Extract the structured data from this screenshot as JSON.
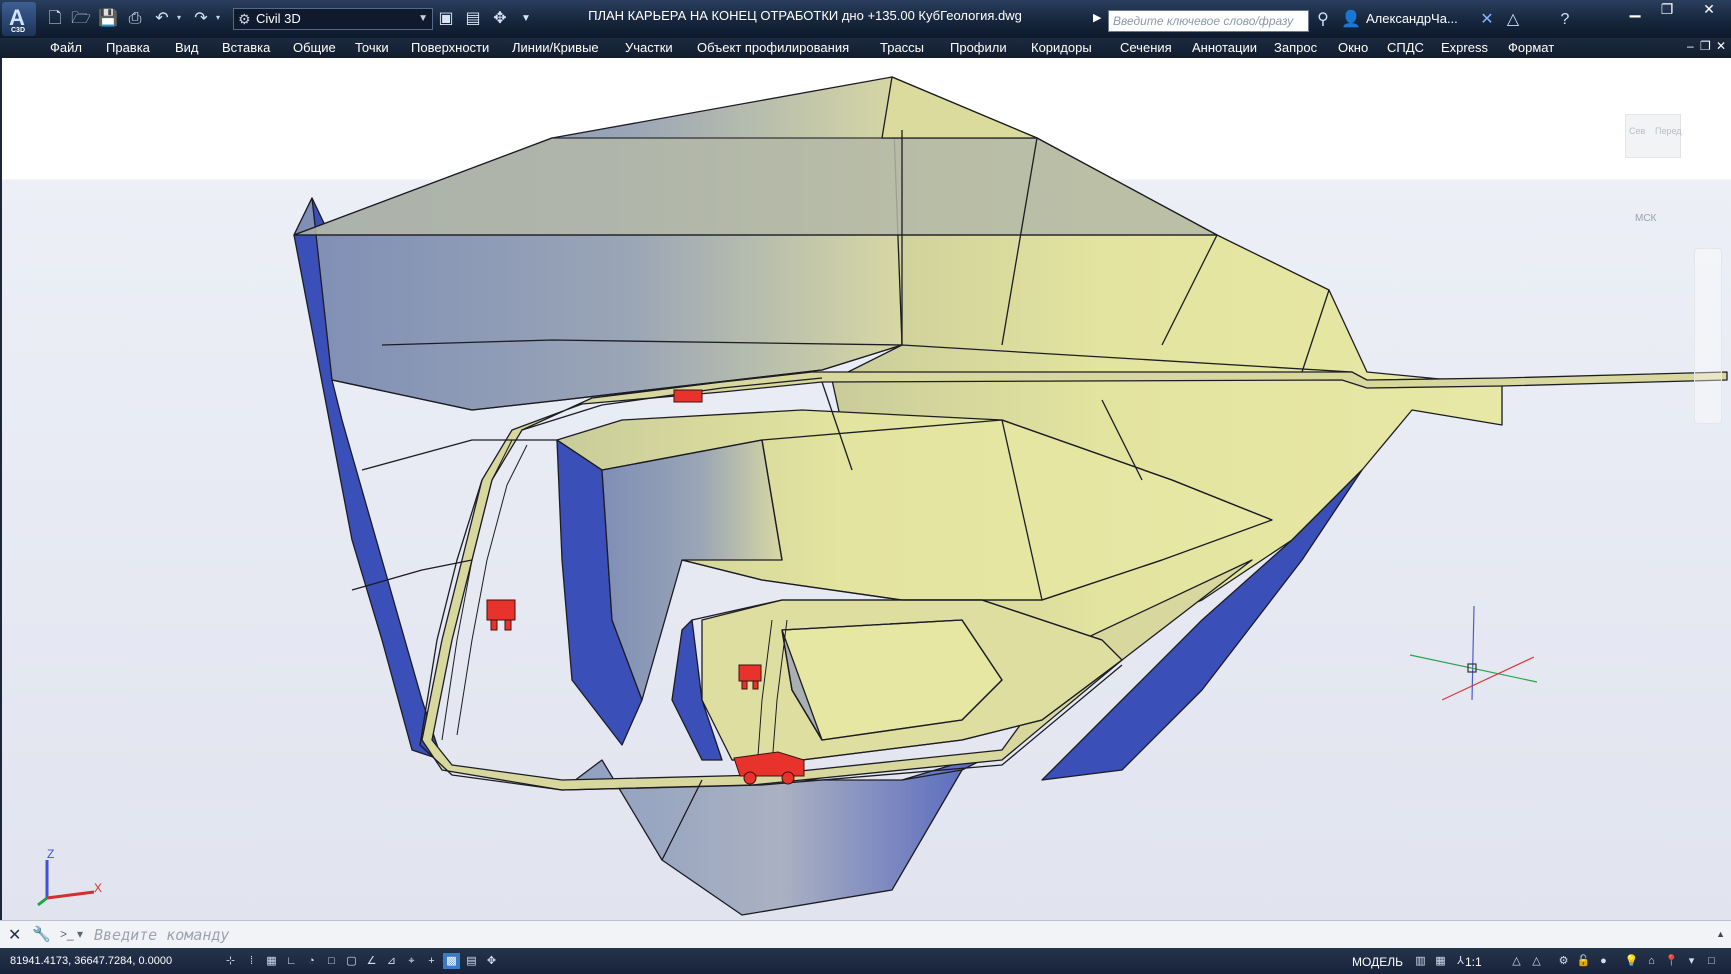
{
  "titlebar": {
    "app_letter": "A",
    "app_sub": "C3D",
    "workspace": "Civil 3D",
    "document_title": "ПЛАН КАРЬЕРА НА КОНЕЦ ОТРАБОТКИ дно +135.00 КубГеология.dwg",
    "search_placeholder": "Введите ключевое слово/фразу",
    "user_name": "АлександрЧа...",
    "help_icon": "?"
  },
  "menu": {
    "items": [
      "Файл",
      "Правка",
      "Вид",
      "Вставка",
      "Общие",
      "Точки",
      "Поверхности",
      "Линии/Кривые",
      "Участки",
      "Объект профилирования",
      "Трассы",
      "Профили",
      "Коридоры",
      "Сечения",
      "Аннотации",
      "Запрос",
      "Окно",
      "СПДС",
      "Express",
      "Формат"
    ]
  },
  "viewport": {
    "viewcube": {
      "top_label": "Сев",
      "front_label": "Перед"
    },
    "wcs_label": "МСК",
    "ucs": {
      "x": "X",
      "y": "Y",
      "z": "Z"
    },
    "colors": {
      "surface_light": "#e3e3a0",
      "surface_shadow": "#3b4fb8",
      "trucks": "#e8332c",
      "edges": "#1c1c24"
    }
  },
  "command_line": {
    "placeholder": "Введите команду"
  },
  "statusbar": {
    "coordinates": "81941.4173, 36647.7284, 0.0000",
    "model_label": "МОДЕЛЬ",
    "scale_label": "1:1"
  }
}
